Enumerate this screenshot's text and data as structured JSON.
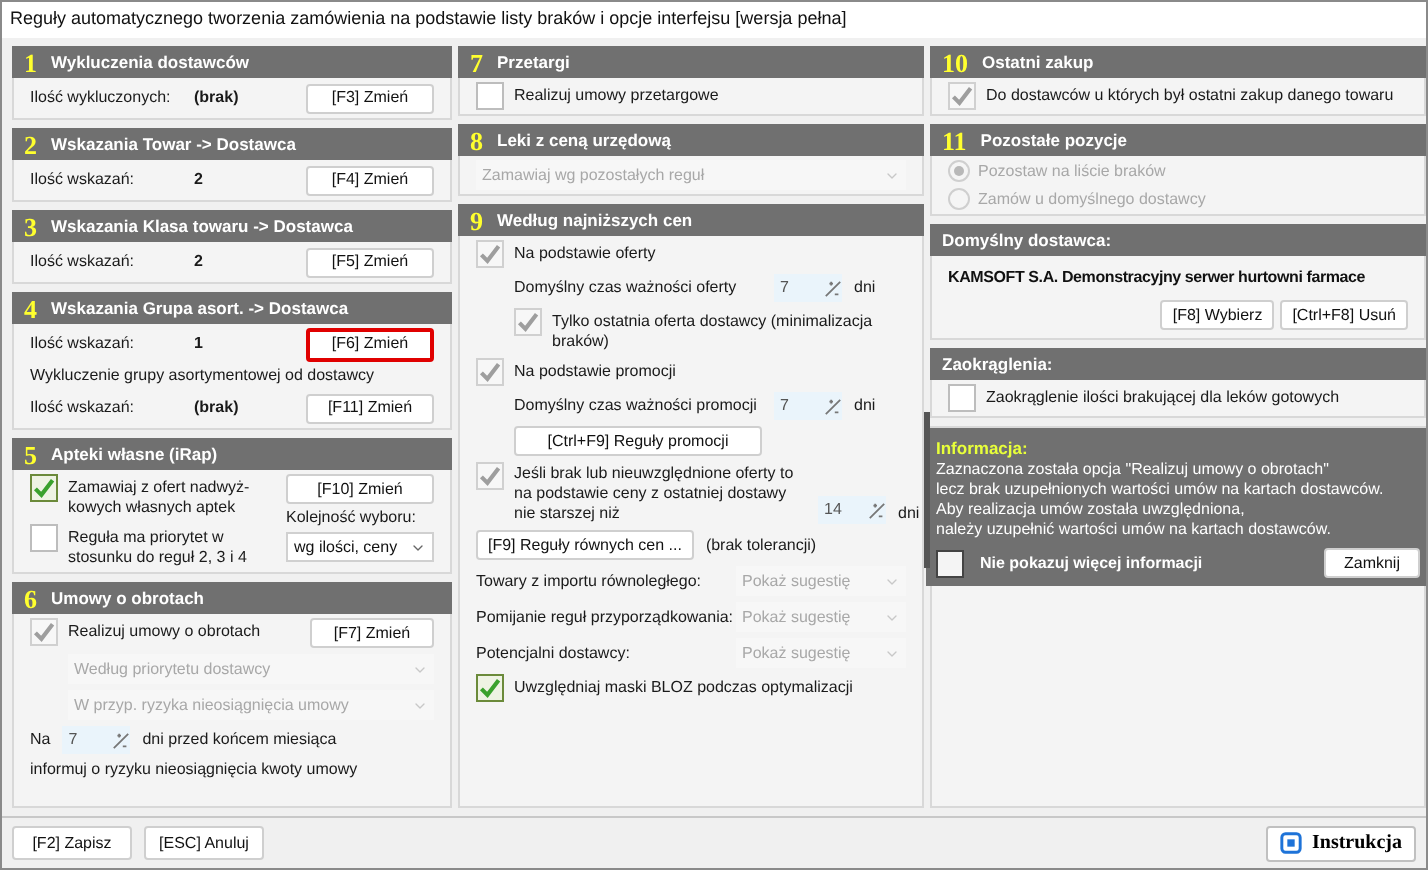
{
  "window": {
    "title": "Reguły automatycznego tworzenia zamówienia na podstawie listy braków i opcje interfejsu [wersja pełna]"
  },
  "columns": [
    {
      "sections": [
        {
          "number": "1",
          "title": "Wykluczenia dostawców",
          "items": [
            {
              "kind": "count",
              "label": "Ilość wykluczonych:",
              "value": "(brak)",
              "button": "[F3] Zmień",
              "highlighted": false
            }
          ]
        },
        {
          "number": "2",
          "title": "Wskazania Towar -> Dostawca",
          "items": [
            {
              "kind": "count",
              "label": "Ilość wskazań:",
              "value": "2",
              "button": "[F4] Zmień",
              "highlighted": false
            }
          ]
        },
        {
          "number": "3",
          "title": "Wskazania Klasa towaru -> Dostawca",
          "items": [
            {
              "kind": "count",
              "label": "Ilość wskazań:",
              "value": "2",
              "button": "[F5] Zmień",
              "highlighted": false
            }
          ]
        },
        {
          "number": "4",
          "title": "Wskazania Grupa asort. -> Dostawca",
          "items": [
            {
              "kind": "count",
              "label": "Ilość wskazań:",
              "value": "1",
              "button": "[F6] Zmień",
              "highlighted": true
            },
            {
              "kind": "note",
              "text": "Wykluczenie grupy asortymentowej od dostawcy"
            },
            {
              "kind": "count",
              "label": "Ilość wskazań:",
              "value": "(brak)",
              "button": "[F11] Zmień",
              "highlighted": false
            }
          ]
        },
        {
          "number": "5",
          "title": "Apteki własne (iRap)",
          "items": [
            {
              "kind": "checkbox",
              "label": "Zamawiaj z ofert nadwyż-kowych własnych aptek",
              "checked": true,
              "disabled": false
            },
            {
              "kind": "checkbox",
              "label": "Reguła ma priorytet w stosunku do reguł 2, 3 i 4",
              "checked": false,
              "disabled": false
            }
          ],
          "aside": [
            {
              "kind": "button",
              "label": "[F10] Zmień"
            },
            {
              "kind": "note",
              "text": "Kolejność wyboru:"
            },
            {
              "kind": "dropdown",
              "value": "wg ilości, ceny",
              "disabled": false
            }
          ]
        },
        {
          "number": "6",
          "title": "Umowy o obrotach",
          "items": [
            {
              "kind": "checkbox",
              "label": "Realizuj umowy o obrotach",
              "checked": true,
              "disabled": true,
              "button": "[F7] Zmień",
              "children": [
                {
                  "kind": "dropdown",
                  "value": "Według priorytetu dostawcy",
                  "disabled": true
                },
                {
                  "kind": "dropdown",
                  "value": "W przyp. ryzyka nieosiągnięcia umowy",
                  "disabled": true
                }
              ]
            },
            {
              "kind": "spin-inline",
              "label": "Na",
              "value": "7",
              "unit": "dni przed końcem miesiąca"
            },
            {
              "kind": "note",
              "text": "informuj o ryzyku nieosiągnięcia kwoty umowy"
            }
          ]
        }
      ]
    },
    {
      "sections": [
        {
          "number": "7",
          "title": "Przetargi",
          "items": [
            {
              "kind": "checkbox",
              "label": "Realizuj umowy przetargowe",
              "checked": false,
              "disabled": false
            }
          ]
        },
        {
          "number": "8",
          "title": "Leki z ceną urzędową",
          "items": [
            {
              "kind": "dropdown",
              "value": "Zamawiaj wg pozostałych reguł",
              "disabled": true
            }
          ]
        },
        {
          "number": "9",
          "title": "Według najniższych cen",
          "scrollbar": true,
          "items": [
            {
              "kind": "checkbox",
              "label": "Na podstawie oferty",
              "checked": true,
              "disabled": true,
              "children": [
                {
                  "kind": "spin",
                  "label": "Domyślny czas ważności oferty",
                  "value": "7",
                  "unit": "dni"
                },
                {
                  "kind": "checkbox",
                  "label": "Tylko ostatnia oferta dostawcy (minimalizacja braków)",
                  "checked": true,
                  "disabled": true
                }
              ]
            },
            {
              "kind": "checkbox",
              "label": "Na podstawie promocji",
              "checked": true,
              "disabled": true,
              "children": [
                {
                  "kind": "spin",
                  "label": "Domyślny czas ważności promocji",
                  "value": "7",
                  "unit": "dni"
                },
                {
                  "kind": "button",
                  "label": "[Ctrl+F9] Reguły promocji"
                }
              ]
            },
            {
              "kind": "checkbox-spin",
              "label": "Jeśli brak lub nieuwzględnione oferty to na podstawie ceny z ostatniej dostawy nie starszej niż",
              "checked": true,
              "disabled": true,
              "value": "14",
              "unit": "dni"
            },
            {
              "kind": "button-note",
              "label": "[F9] Reguły równych cen ...",
              "note": "(brak tolerancji)"
            },
            {
              "kind": "select-row",
              "label": "Towary z importu równoległego:",
              "value": "Pokaż sugestię",
              "disabled": true
            },
            {
              "kind": "select-row",
              "label": "Pomijanie reguł przyporządkowania:",
              "value": "Pokaż sugestię",
              "disabled": true
            },
            {
              "kind": "select-row",
              "label": "Potencjalni dostawcy:",
              "value": "Pokaż sugestię",
              "disabled": true
            },
            {
              "kind": "checkbox",
              "label": "Uwzględniaj maski BLOZ podczas optymalizacji",
              "checked": true,
              "disabled": false
            }
          ]
        }
      ]
    },
    {
      "sections": [
        {
          "number": "10",
          "title": "Ostatni zakup",
          "items": [
            {
              "kind": "checkbox",
              "label": "Do dostawców u których był ostatni zakup danego towaru",
              "checked": true,
              "disabled": true
            }
          ]
        },
        {
          "number": "11",
          "title": "Pozostałe pozycje",
          "items": [
            {
              "kind": "radio",
              "label": "Pozostaw na liście braków",
              "selected": true,
              "disabled": true
            },
            {
              "kind": "radio",
              "label": "Zamów u domyślnego dostawcy",
              "selected": false,
              "disabled": true
            }
          ]
        },
        {
          "title": "Domyślny dostawca:",
          "items": [
            {
              "kind": "text",
              "text": "KAMSOFT S.A. Demonstracyjny serwer hurtowni farmace"
            },
            {
              "kind": "buttons",
              "buttons": [
                "[F8] Wybierz",
                "[Ctrl+F8] Usuń"
              ]
            }
          ]
        },
        {
          "title": "Zaokrąglenia:",
          "items": [
            {
              "kind": "checkbox",
              "label": "Zaokrąglenie ilości brakującej dla leków gotowych",
              "checked": false,
              "disabled": false
            }
          ]
        }
      ]
    }
  ],
  "info": {
    "title": "Informacja:",
    "lines": [
      "Zaznaczona została opcja \"Realizuj umowy o obrotach\"",
      "lecz brak uzupełnionych wartości umów na kartach dostawców.",
      "Aby realizacja umów została uwzględniona,",
      "należy uzupełnić wartości umów na kartach dostawców."
    ],
    "checkbox": {
      "label": "Nie pokazuj więcej informacji",
      "checked": false
    },
    "button": "Zamknij"
  },
  "footer": {
    "buttons": [
      "[F2] Zapisz",
      "[ESC] Anuluj"
    ],
    "help": "Instrukcja"
  }
}
